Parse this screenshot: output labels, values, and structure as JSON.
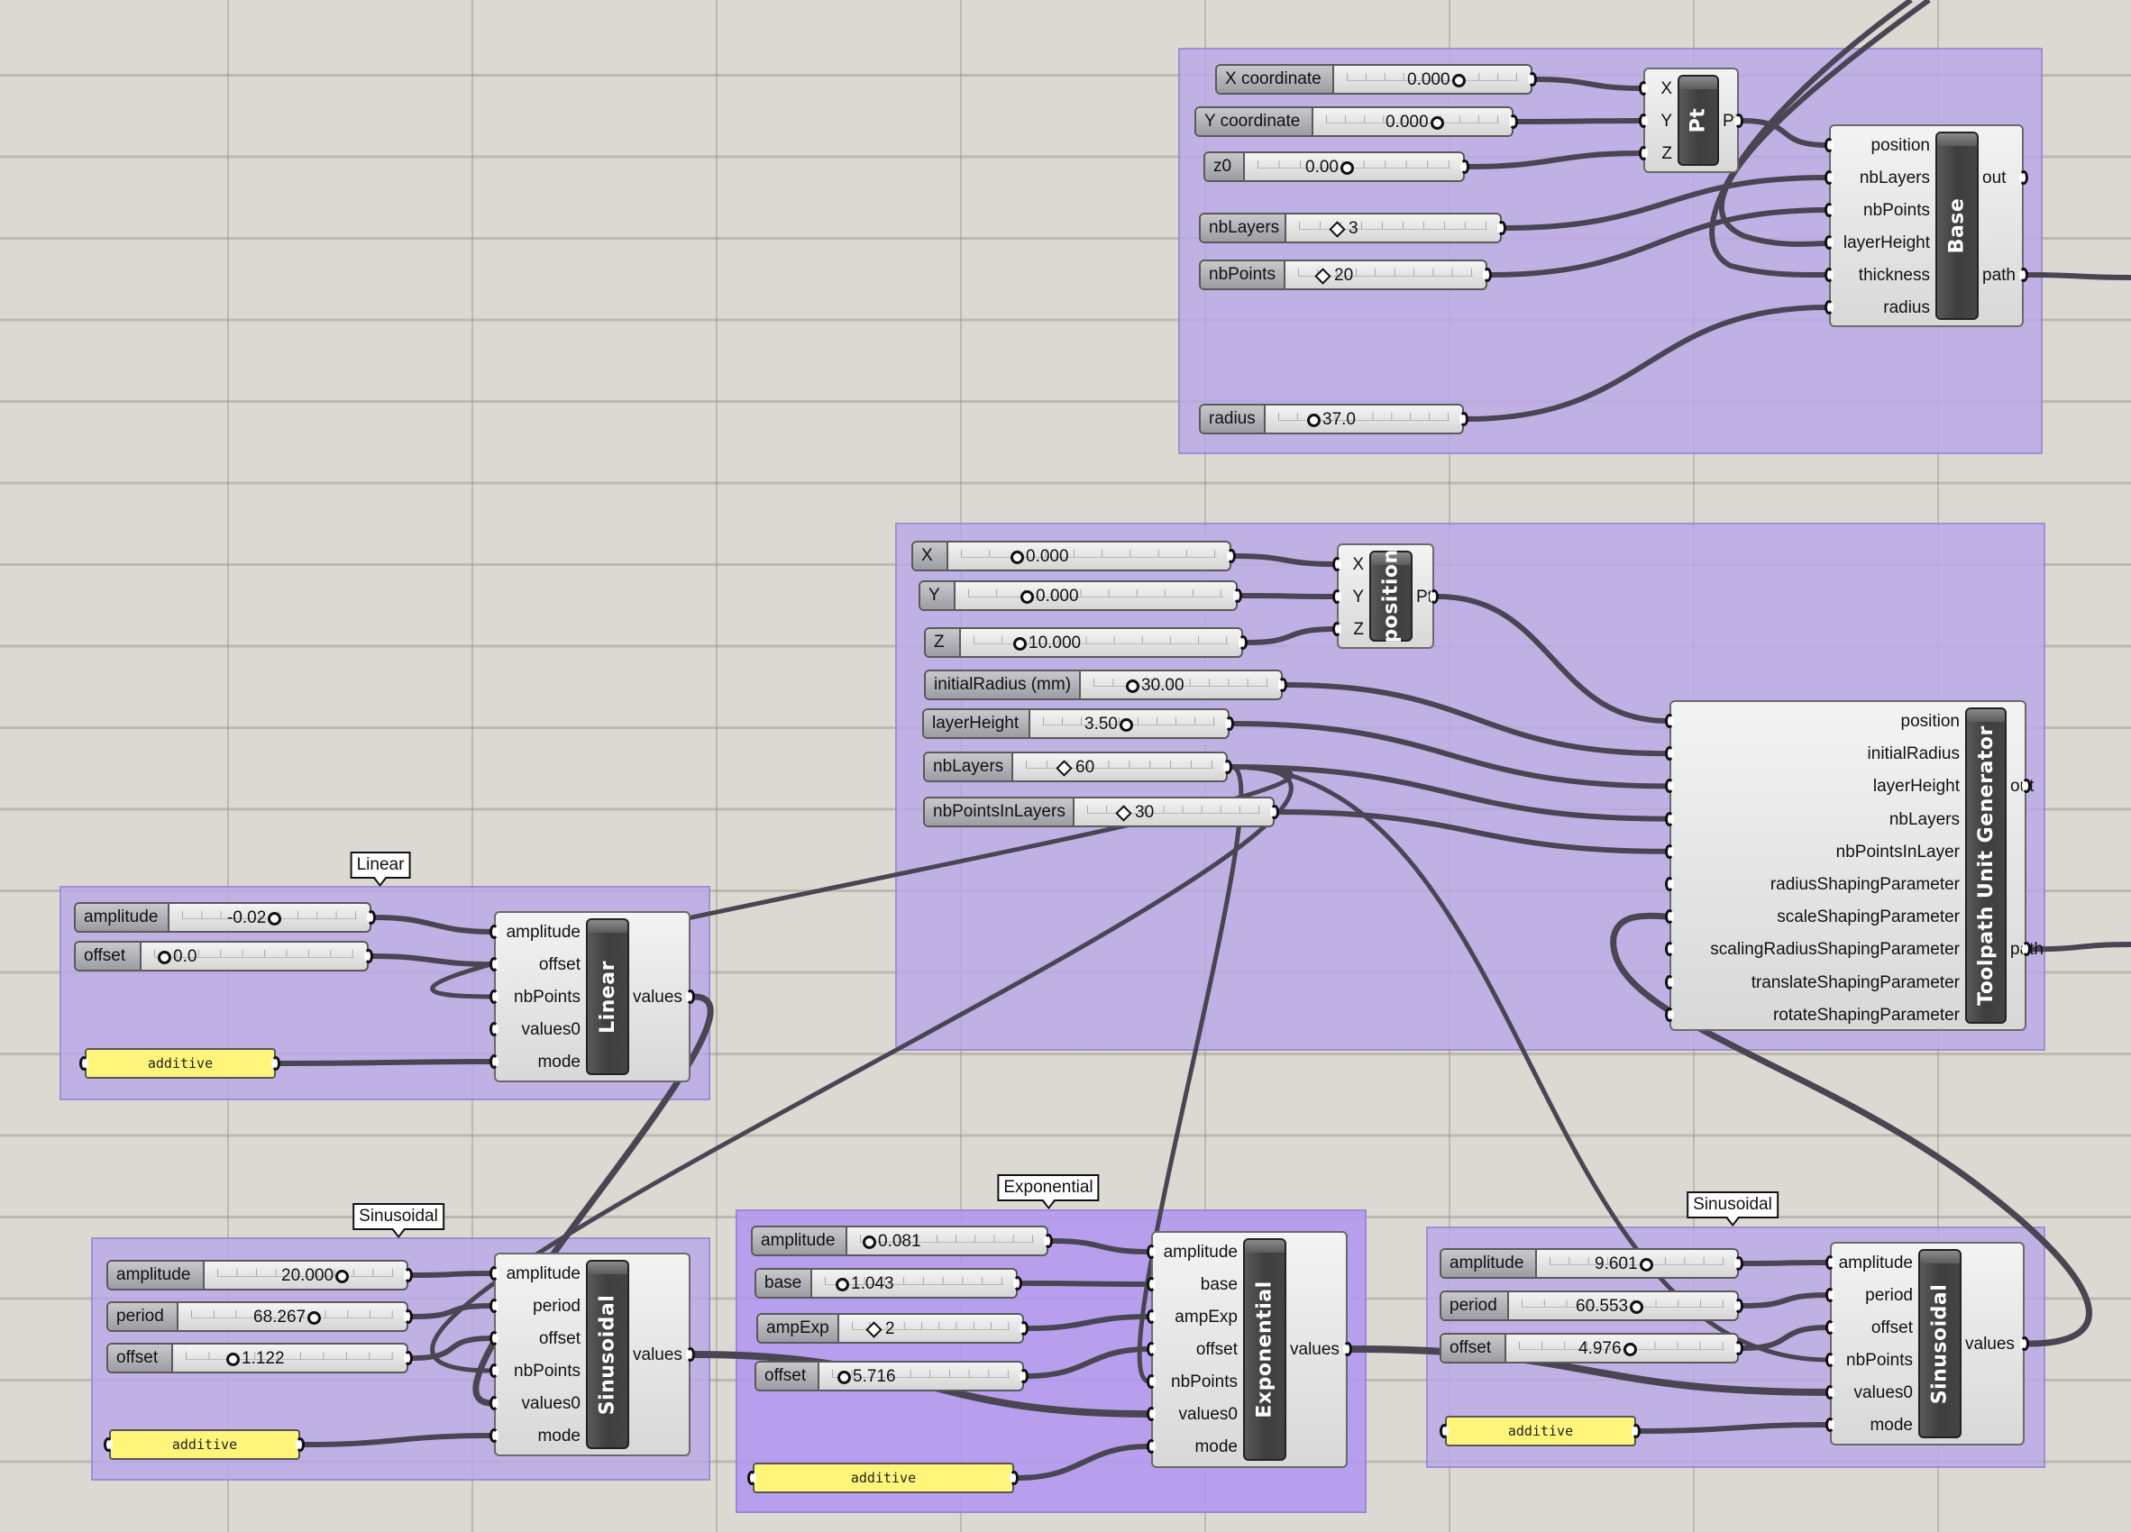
{
  "groups": [
    {
      "id": "base-group",
      "label": null
    },
    {
      "id": "toolpath-group",
      "label": null
    },
    {
      "id": "linear-group",
      "label": "Linear"
    },
    {
      "id": "sinusoidal-left-group",
      "label": "Sinusoidal"
    },
    {
      "id": "exponential-group",
      "label": "Exponential",
      "selected": true
    },
    {
      "id": "sinusoidal-right-group",
      "label": "Sinusoidal"
    }
  ],
  "base_group": {
    "sliders": [
      {
        "name": "X coordinate",
        "value": "0.000",
        "grip": "float"
      },
      {
        "name": "Y coordinate",
        "value": "0.000",
        "grip": "float"
      },
      {
        "name": "z0",
        "value": "0.00",
        "grip": "float"
      },
      {
        "name": "nbLayers",
        "value": "3",
        "grip": "integer"
      },
      {
        "name": "nbPoints",
        "value": "20",
        "grip": "integer"
      },
      {
        "name": "radius",
        "value": "37.0",
        "grip": "float"
      }
    ],
    "pt_component": {
      "title": "Pt",
      "inputs": [
        "X",
        "Y",
        "Z"
      ],
      "outputs": [
        "Pt"
      ]
    },
    "base_component": {
      "title": "Base",
      "inputs": [
        "position",
        "nbLayers",
        "nbPoints",
        "layerHeight",
        "thickness",
        "radius"
      ],
      "outputs": [
        "out",
        "path"
      ]
    }
  },
  "toolpath_group": {
    "sliders": [
      {
        "name": "X",
        "value": "0.000",
        "grip": "float"
      },
      {
        "name": "Y",
        "value": "0.000",
        "grip": "float"
      },
      {
        "name": "Z",
        "value": "10.000",
        "grip": "float"
      },
      {
        "name": "initialRadius (mm)",
        "value": "30.00",
        "grip": "float"
      },
      {
        "name": "layerHeight",
        "value": "3.50",
        "grip": "float"
      },
      {
        "name": "nbLayers",
        "value": "60",
        "grip": "integer"
      },
      {
        "name": "nbPointsInLayers",
        "value": "30",
        "grip": "integer"
      }
    ],
    "position_component": {
      "title": "position",
      "inputs": [
        "X",
        "Y",
        "Z"
      ],
      "outputs": [
        "Pt"
      ]
    },
    "generator_component": {
      "title": "Toolpath Unit Generator",
      "inputs": [
        "position",
        "initialRadius",
        "layerHeight",
        "nbLayers",
        "nbPointsInLayer",
        "radiusShapingParameter",
        "scaleShapingParameter",
        "scalingRadiusShapingParameter",
        "translateShapingParameter",
        "rotateShapingParameter"
      ],
      "outputs": [
        "out",
        "path"
      ]
    }
  },
  "linear_group": {
    "label": "Linear",
    "sliders": [
      {
        "name": "amplitude",
        "value": "-0.02",
        "grip": "float"
      },
      {
        "name": "offset",
        "value": "0.0",
        "grip": "float"
      }
    ],
    "panel": "additive",
    "component": {
      "title": "Linear",
      "inputs": [
        "amplitude",
        "offset",
        "nbPoints",
        "values0",
        "mode"
      ],
      "outputs": [
        "values"
      ]
    }
  },
  "sinusoidal_left_group": {
    "label": "Sinusoidal",
    "sliders": [
      {
        "name": "amplitude",
        "value": "20.000",
        "grip": "float"
      },
      {
        "name": "period",
        "value": "68.267",
        "grip": "float"
      },
      {
        "name": "offset",
        "value": "1.122",
        "grip": "float"
      }
    ],
    "panel": "additive",
    "component": {
      "title": "Sinusoidal",
      "inputs": [
        "amplitude",
        "period",
        "offset",
        "nbPoints",
        "values0",
        "mode"
      ],
      "outputs": [
        "values"
      ]
    }
  },
  "exponential_group": {
    "label": "Exponential",
    "sliders": [
      {
        "name": "amplitude",
        "value": "0.081",
        "grip": "float"
      },
      {
        "name": "base",
        "value": "1.043",
        "grip": "float"
      },
      {
        "name": "ampExp",
        "value": "2",
        "grip": "integer"
      },
      {
        "name": "offset",
        "value": "5.716",
        "grip": "float"
      }
    ],
    "panel": "additive",
    "component": {
      "title": "Exponential",
      "inputs": [
        "amplitude",
        "base",
        "ampExp",
        "offset",
        "nbPoints",
        "values0",
        "mode"
      ],
      "outputs": [
        "values"
      ]
    }
  },
  "sinusoidal_right_group": {
    "label": "Sinusoidal",
    "sliders": [
      {
        "name": "amplitude",
        "value": "9.601",
        "grip": "float"
      },
      {
        "name": "period",
        "value": "60.553",
        "grip": "float"
      },
      {
        "name": "offset",
        "value": "4.976",
        "grip": "float"
      }
    ],
    "panel": "additive",
    "component": {
      "title": "Sinusoidal",
      "inputs": [
        "amplitude",
        "period",
        "offset",
        "nbPoints",
        "values0",
        "mode"
      ],
      "outputs": [
        "values"
      ]
    }
  },
  "colors": {
    "canvas": "#dcd9d2",
    "group": "#c3b6ea",
    "group_selected": "#bba4f2",
    "wire": "#4a4552",
    "panel": "#fff57a",
    "component_bar": "#444444"
  }
}
